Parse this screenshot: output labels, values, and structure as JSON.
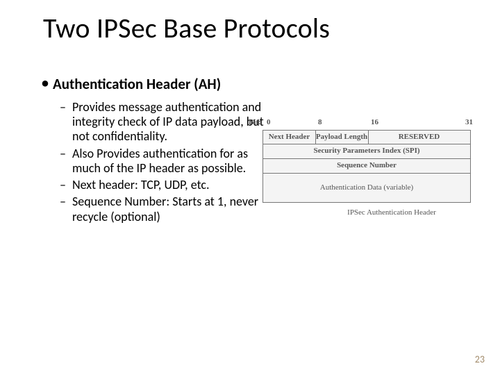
{
  "title": "Two IPSec Base Protocols",
  "bullet1": "Authentication Header (AH)",
  "sub": {
    "a": "Provides message authentication and integrity check of IP data payload, but not confidentiality.",
    "b": "Also Provides authentication for as much of the IP header as possible.",
    "c": "Next header: TCP, UDP, etc.",
    "d": "Sequence Number: Starts at 1, never recycle (optional)"
  },
  "diag": {
    "bit_label": "Bit:",
    "bits": {
      "b0": "0",
      "b8": "8",
      "b16": "16",
      "b31": "31"
    },
    "r1": {
      "next": "Next Header",
      "paylen": "Payload Length",
      "res": "RESERVED"
    },
    "r2": "Security Parameters Index (SPI)",
    "r3": "Sequence Number",
    "r4": "Authentication Data (variable)",
    "caption": "IPSec Authentication Header"
  },
  "pagenum": "23"
}
